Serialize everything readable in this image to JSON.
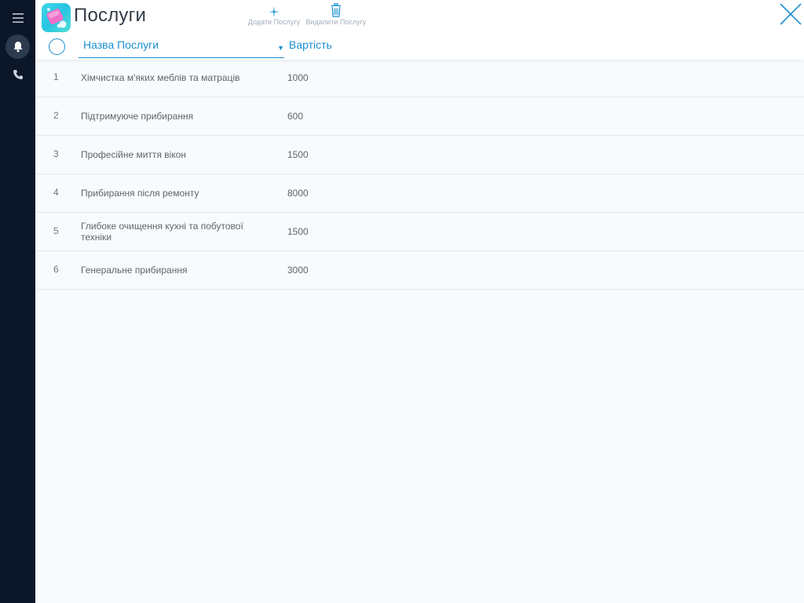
{
  "sidebar": {
    "items": [
      {
        "icon": "menu-icon"
      },
      {
        "icon": "bell-icon",
        "active": true
      },
      {
        "icon": "phone-icon"
      }
    ]
  },
  "header": {
    "title": "Послуги",
    "add_label": "Додати Послугу",
    "delete_label": "Видалити Послугу"
  },
  "columns": {
    "name": "Назва Послуги",
    "sort_indicator": "▼",
    "price": "Вартість"
  },
  "rows": [
    {
      "num": "1",
      "name": "Хімчистка м'яких меблів та матраців",
      "price": "1000"
    },
    {
      "num": "2",
      "name": "Підтримуюче прибирання",
      "price": "600"
    },
    {
      "num": "3",
      "name": "Професійне миття вікон",
      "price": "1500"
    },
    {
      "num": "4",
      "name": "Прибирання після ремонту",
      "price": "8000"
    },
    {
      "num": "5",
      "name": "Глибоке очищення кухні та побутової техніки",
      "price": "1500"
    },
    {
      "num": "6",
      "name": "Генеральне прибирання",
      "price": "3000"
    }
  ],
  "colors": {
    "accent": "#1a8fd1",
    "sidebar_bg": "#0b1729",
    "page_bg": "#f7fbfd"
  }
}
